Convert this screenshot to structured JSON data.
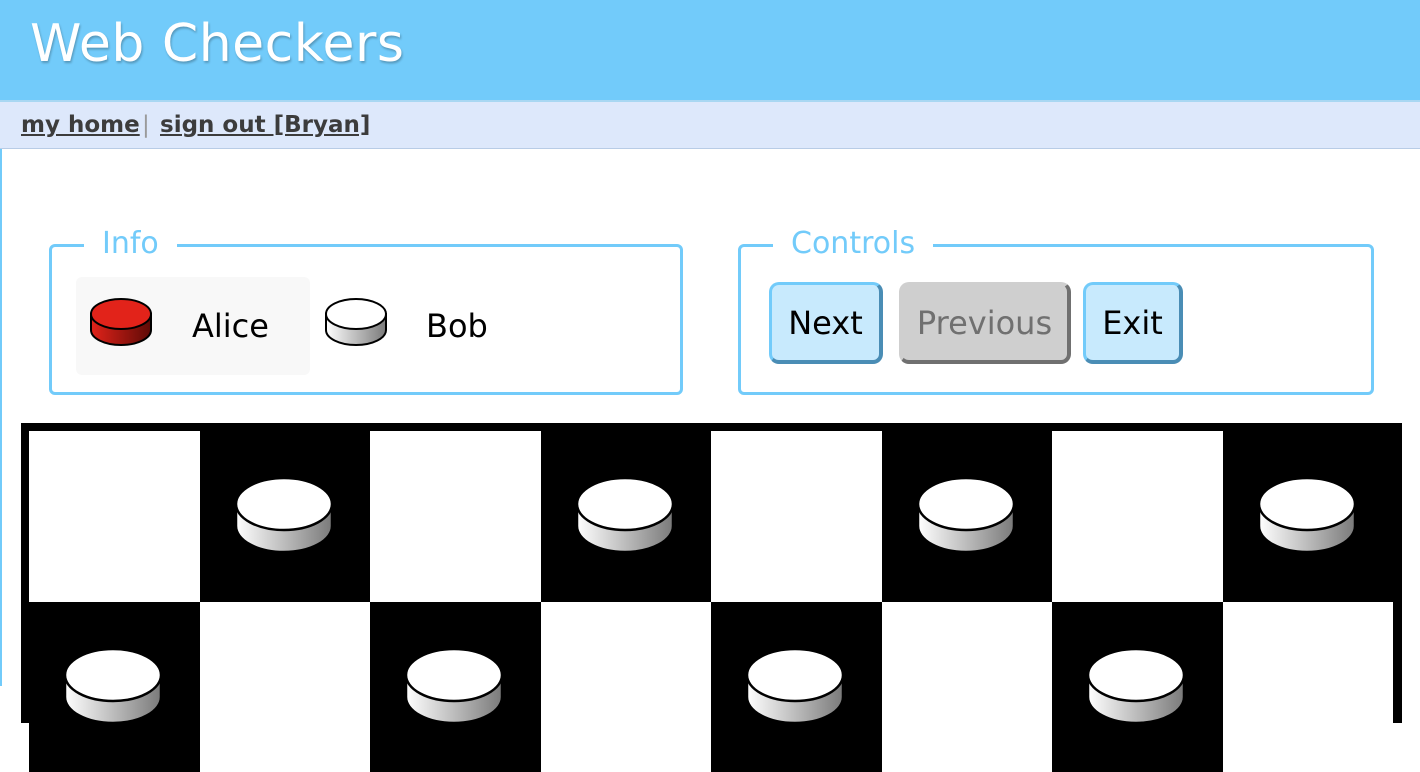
{
  "app": {
    "title": "Web Checkers"
  },
  "nav": {
    "home_label": "my home",
    "separator": "|",
    "signout_label": "sign out [Bryan]"
  },
  "info": {
    "legend": "Info",
    "players": [
      {
        "name": "Alice",
        "color": "red",
        "active": true
      },
      {
        "name": "Bob",
        "color": "white",
        "active": false
      }
    ]
  },
  "controls": {
    "legend": "Controls",
    "buttons": [
      {
        "label": "Next",
        "enabled": true
      },
      {
        "label": "Previous",
        "enabled": false
      },
      {
        "label": "Exit",
        "enabled": true
      }
    ]
  },
  "board": {
    "size": 8,
    "visible_rows": [
      [
        "",
        "white",
        "",
        "white",
        "",
        "white",
        "",
        "white"
      ],
      [
        "white",
        "",
        "white",
        "",
        "white",
        "",
        "white",
        ""
      ]
    ]
  },
  "colors": {
    "accent": "#72cbfa",
    "nav_bg": "#dde8fb",
    "red_piece": "#e2231a",
    "white_piece": "#ffffff"
  }
}
